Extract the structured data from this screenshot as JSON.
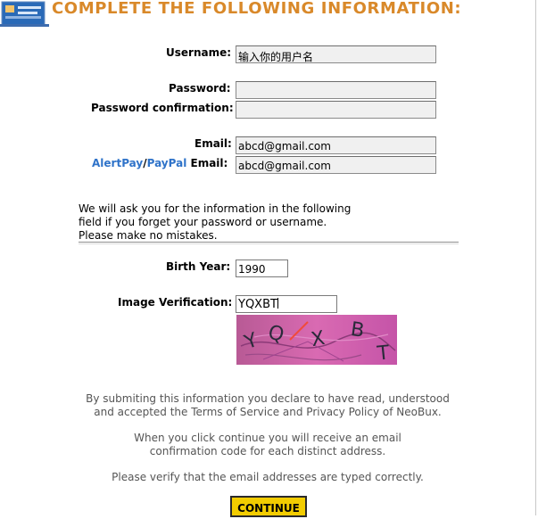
{
  "header": {
    "title": "COMPLETE THE FOLLOWING INFORMATION:"
  },
  "form": {
    "username": {
      "label": "Username:",
      "value": "输入你的用户名"
    },
    "password": {
      "label": "Password:",
      "value": ""
    },
    "password_confirmation": {
      "label": "Password confirmation:",
      "value": ""
    },
    "email": {
      "label": "Email:",
      "value": "abcd@gmail.com"
    },
    "payment_email": {
      "alertpay": "AlertPay",
      "separator": "/",
      "paypal": "PayPal",
      "label": " Email:",
      "value": "abcd@gmail.com"
    },
    "notice": [
      "We will ask you for the information in the following",
      "field if you forget your password or username.",
      "Please make no mistakes."
    ],
    "birth_year": {
      "label": "Birth Year:",
      "value": "1990"
    },
    "image_verification": {
      "label": "Image Verification:",
      "value": "YQXBT"
    },
    "captcha_text": [
      "Y",
      "Q",
      "X",
      "B",
      "T"
    ]
  },
  "footer": {
    "terms_1": "By submiting this information you declare to have read, understood",
    "terms_2": "and accepted the Terms of Service and Privacy Policy of NeoBux.",
    "confirm_1": "When you click continue you will receive an email",
    "confirm_2": "confirmation code for each distinct address.",
    "verify": "Please verify that the email addresses are typed correctly."
  },
  "continue_button": {
    "label": "CONTINUE"
  },
  "colors": {
    "title": "#d9892a",
    "link": "#2f73c9",
    "button": "#f2cc00"
  }
}
